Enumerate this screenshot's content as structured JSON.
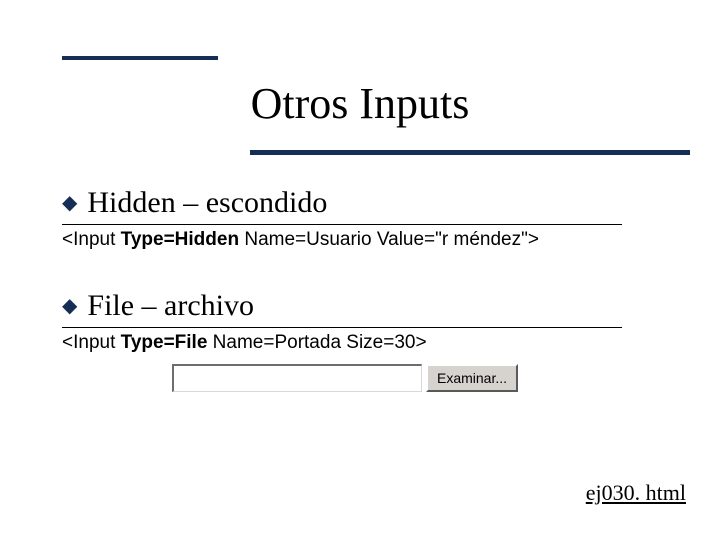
{
  "title": "Otros Inputs",
  "items": [
    {
      "heading": "Hidden – escondido",
      "code_pre": "<Input ",
      "code_bold": "Type=Hidden",
      "code_post": " Name=Usuario Value=\"r méndez\">"
    },
    {
      "heading": "File – archivo",
      "code_pre": "<Input ",
      "code_bold": "Type=File",
      "code_post": " Name=Portada Size=30>"
    }
  ],
  "browse_label": "Examinar...",
  "footer": "ej030. html"
}
